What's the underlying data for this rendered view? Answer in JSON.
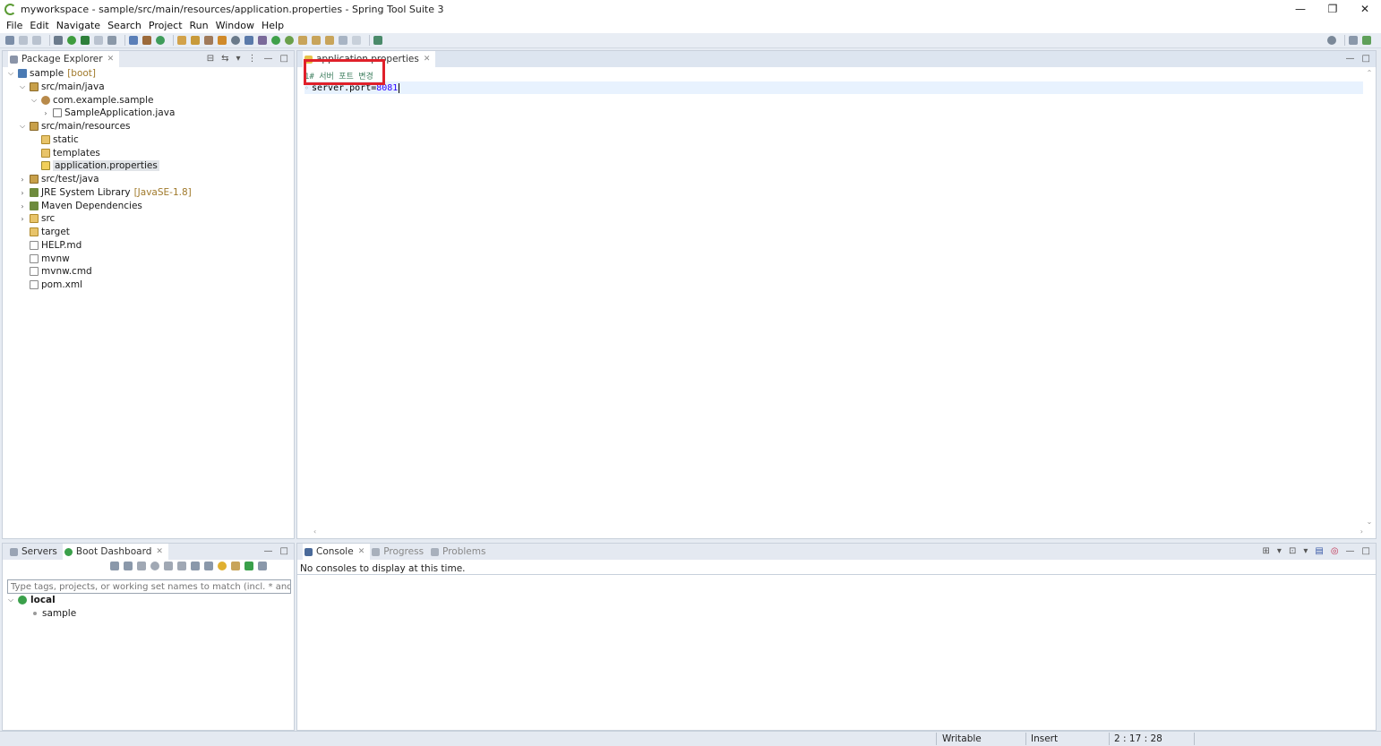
{
  "window": {
    "title": "myworkspace - sample/src/main/resources/application.properties - Spring Tool Suite 3",
    "controls": [
      "—",
      "❐",
      "✕"
    ]
  },
  "menu": [
    "File",
    "Edit",
    "Navigate",
    "Search",
    "Project",
    "Run",
    "Window",
    "Help"
  ],
  "package_explorer": {
    "tab_label": "Package Explorer",
    "tree": [
      {
        "label": "sample",
        "decoration": "[boot]",
        "icon": "project-icon",
        "twisty": "open"
      },
      {
        "label": "src/main/java",
        "icon": "source-folder-icon",
        "twisty": "open"
      },
      {
        "label": "com.example.sample",
        "icon": "package-icon",
        "twisty": "open"
      },
      {
        "label": "SampleApplication.java",
        "icon": "java-file-icon",
        "twisty": "closed"
      },
      {
        "label": "src/main/resources",
        "icon": "source-folder-icon",
        "twisty": "open"
      },
      {
        "label": "static",
        "icon": "folder-icon",
        "twisty": "none"
      },
      {
        "label": "templates",
        "icon": "folder-icon",
        "twisty": "none"
      },
      {
        "label": "application.properties",
        "icon": "properties-file-icon",
        "twisty": "none",
        "selected": true
      },
      {
        "label": "src/test/java",
        "icon": "source-folder-icon",
        "twisty": "closed"
      },
      {
        "label": "JRE System Library",
        "decoration": "[JavaSE-1.8]",
        "icon": "library-icon",
        "twisty": "closed"
      },
      {
        "label": "Maven Dependencies",
        "icon": "library-icon",
        "twisty": "closed"
      },
      {
        "label": "src",
        "icon": "folder-icon",
        "twisty": "closed"
      },
      {
        "label": "target",
        "icon": "folder-icon",
        "twisty": "none"
      },
      {
        "label": "HELP.md",
        "icon": "file-icon",
        "twisty": "none"
      },
      {
        "label": "mvnw",
        "icon": "file-icon",
        "twisty": "none"
      },
      {
        "label": "mvnw.cmd",
        "icon": "file-icon",
        "twisty": "none"
      },
      {
        "label": "pom.xml",
        "icon": "xml-file-icon",
        "twisty": "none"
      }
    ]
  },
  "editor": {
    "tab_label": "application.properties",
    "lines": [
      {
        "text": "1# 서버 포트 변경",
        "kind": "comment"
      },
      {
        "key": "server.port=",
        "value": "8081",
        "kind": "property",
        "current": true
      }
    ]
  },
  "boot_dashboard": {
    "tabs": [
      "Servers",
      "Boot Dashboard"
    ],
    "filter_placeholder": "Type tags, projects, or working set names to match (incl. * and ? wildcards)",
    "tree": [
      {
        "label": "local",
        "bold": true
      },
      {
        "label": "sample"
      }
    ]
  },
  "console": {
    "tabs": [
      "Console",
      "Progress",
      "Problems"
    ],
    "message": "No consoles to display at this time."
  },
  "status_bar": {
    "writable": "Writable",
    "insert_mode": "Insert",
    "position": "2 : 17 : 28"
  }
}
